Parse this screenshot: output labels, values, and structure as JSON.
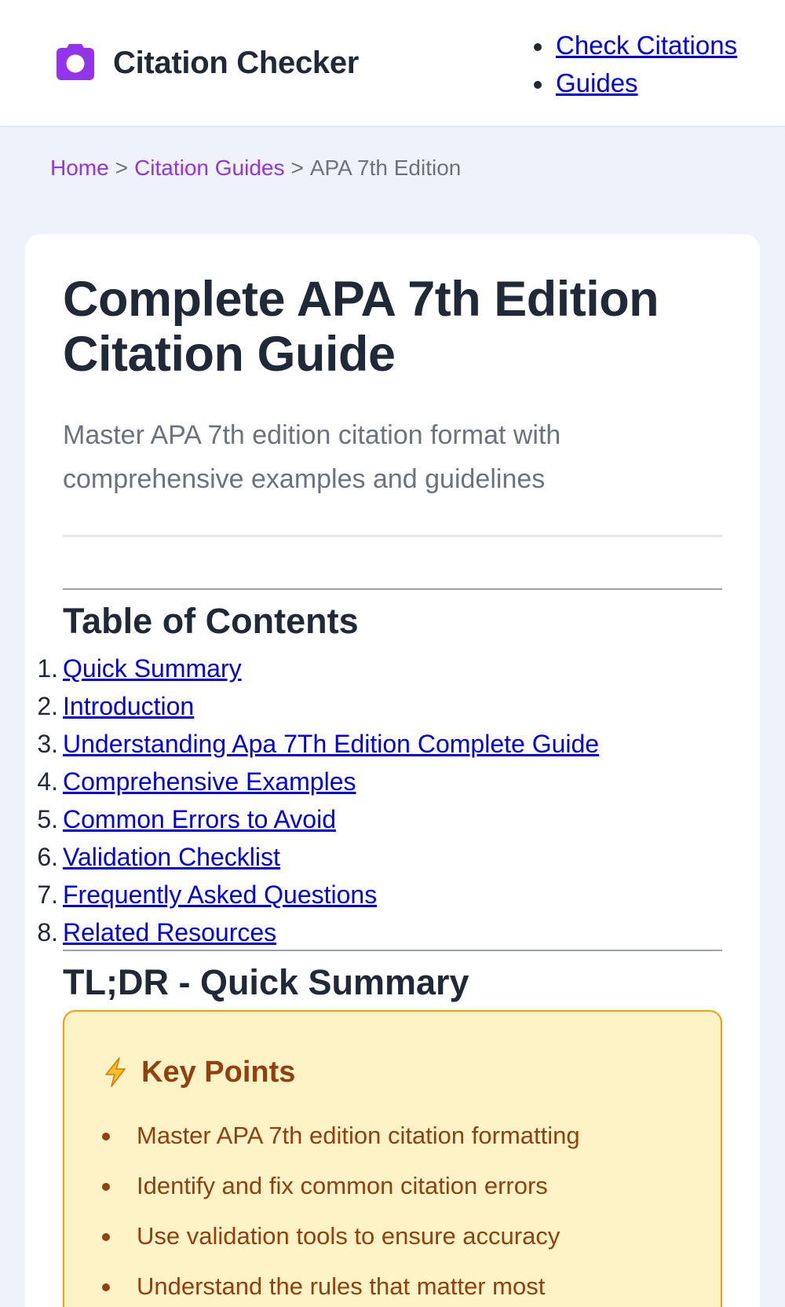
{
  "header": {
    "logo_icon": "camera-icon",
    "brand_color": "#9333ea",
    "site_name": "Citation Checker",
    "nav": [
      {
        "label": "Check Citations"
      },
      {
        "label": "Guides"
      }
    ]
  },
  "breadcrumb": {
    "items": [
      {
        "label": "Home"
      },
      {
        "label": "Citation Guides"
      }
    ],
    "separator": ">",
    "current": "APA 7th Edition"
  },
  "article": {
    "title": "Complete APA 7th Edition Citation Guide",
    "subtitle": "Master APA 7th edition citation format with comprehensive examples and guidelines"
  },
  "toc": {
    "title": "Table of Contents",
    "items": [
      {
        "num": "1.",
        "label": "Quick Summary"
      },
      {
        "num": "2.",
        "label": "Introduction"
      },
      {
        "num": "3.",
        "label": "Understanding Apa 7Th Edition Complete Guide"
      },
      {
        "num": "4.",
        "label": "Comprehensive Examples"
      },
      {
        "num": "5.",
        "label": "Common Errors to Avoid"
      },
      {
        "num": "6.",
        "label": "Validation Checklist"
      },
      {
        "num": "7.",
        "label": "Frequently Asked Questions"
      },
      {
        "num": "8.",
        "label": "Related Resources"
      }
    ]
  },
  "summary": {
    "title": "TL;DR - Quick Summary",
    "key_points": {
      "icon": "lightning-icon",
      "title": "Key Points",
      "items": [
        "Master APA 7th edition citation formatting",
        "Identify and fix common citation errors",
        "Use validation tools to ensure accuracy",
        "Understand the rules that matter most"
      ]
    }
  }
}
